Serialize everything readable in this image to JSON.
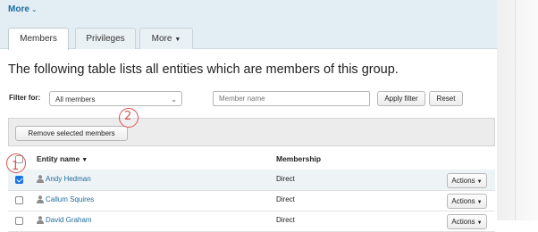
{
  "header": {
    "more_label": "More"
  },
  "tabs": [
    {
      "label": "Members"
    },
    {
      "label": "Privileges"
    },
    {
      "label": "More"
    }
  ],
  "heading": "The following table lists all entities which are members of this group.",
  "filter": {
    "label": "Filter for:",
    "select_value": "All members",
    "name_placeholder": "Member name",
    "apply_label": "Apply filter",
    "reset_label": "Reset"
  },
  "toolbar": {
    "remove_label": "Remove selected members"
  },
  "table": {
    "columns": {
      "entity": "Entity name",
      "membership": "Membership"
    },
    "rows": [
      {
        "name": "Andy Hedman",
        "membership": "Direct",
        "action": "Actions",
        "checked": true
      },
      {
        "name": "Callum Squires",
        "membership": "Direct",
        "action": "Actions",
        "checked": false
      },
      {
        "name": "David Graham",
        "membership": "Direct",
        "action": "Actions",
        "checked": false
      }
    ]
  },
  "annotations": [
    {
      "number": "1"
    },
    {
      "number": "2"
    }
  ],
  "colors": {
    "link": "#1f6d9d",
    "header_bar": "#e3eef4",
    "annotation": "#d9534f",
    "checkbox_checked": "#1a73e8"
  }
}
